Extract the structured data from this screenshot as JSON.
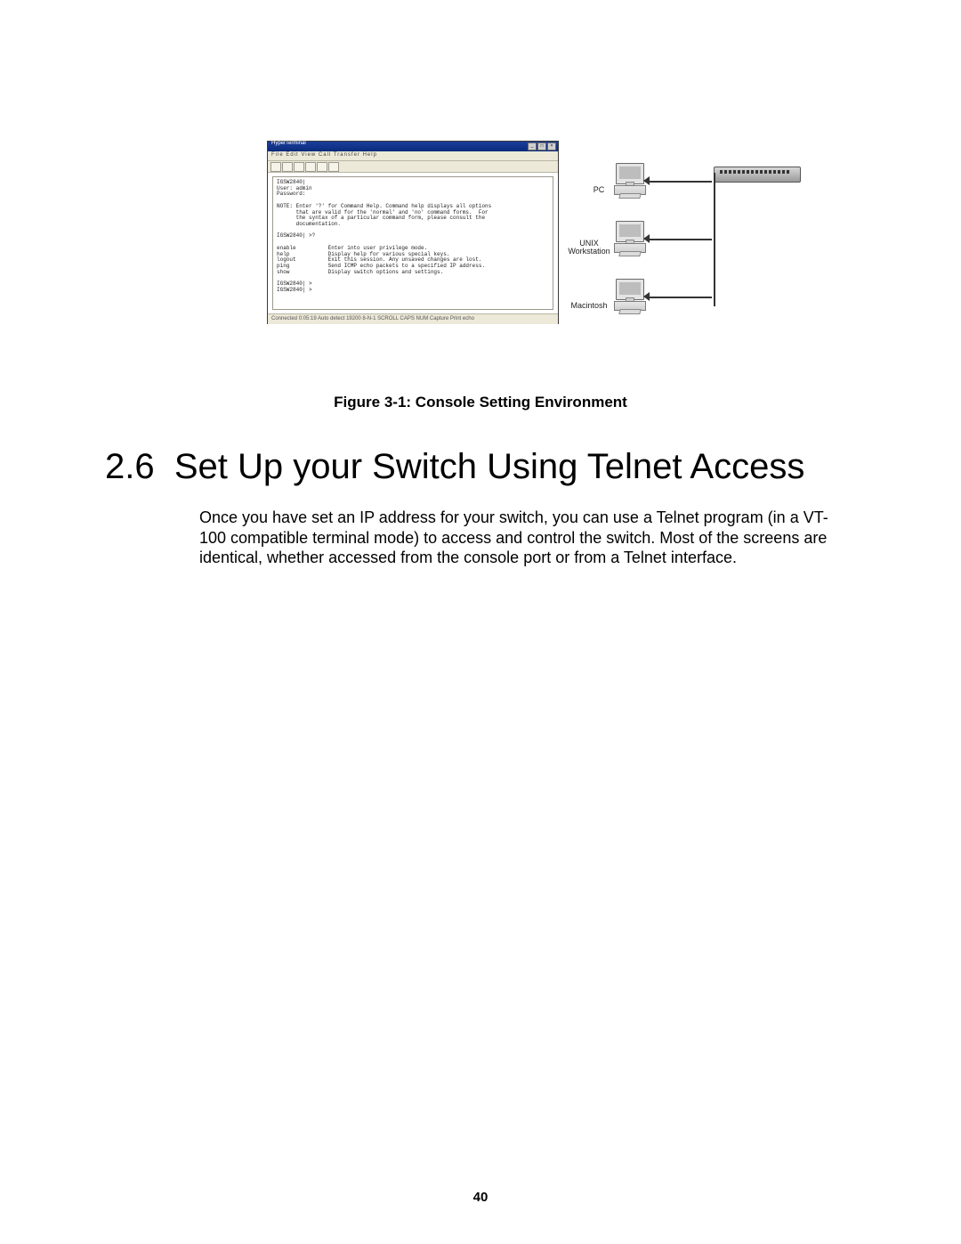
{
  "page_number": "40",
  "figure_caption": "Figure 3-1: Console Setting Environment",
  "section": {
    "number": "2.6",
    "title": "Set Up your Switch Using Telnet Access",
    "paragraph": "Once you have set an IP address for your switch, you can use a Telnet program (in a VT-100 compatible terminal mode) to access and control the switch. Most of the screens are identical, whether accessed from the console port or from a Telnet interface."
  },
  "terminal": {
    "title": "HyperTerminal",
    "menubar": "File  Edit  View  Call  Transfer  Help",
    "statusbar": "Connected 0:05:19   Auto detect   19200   8-N-1   SCROLL   CAPS   NUM   Capture   Print echo",
    "content": "IGSW2840|\nUser: admin\nPassword:\n\nNOTE: Enter '?' for Command Help. Command help displays all options\n      that are valid for the 'normal' and 'no' command forms.  For\n      the syntax of a particular command form, please consult the\n      documentation.\n\nIGSW2840| >?\n\nenable          Enter into user privilege mode.\nhelp            Display help for various special keys.\nlogout          Exit this session. Any unsaved changes are lost.\nping            Send ICMP echo packets to a specified IP address.\nshow            Display switch options and settings.\n\nIGSW2840| >\nIGSW2840| >"
  },
  "diagram": {
    "pc_label": "PC",
    "unix_label": "UNIX\nWorkstation",
    "mac_label": "Macintosh"
  }
}
